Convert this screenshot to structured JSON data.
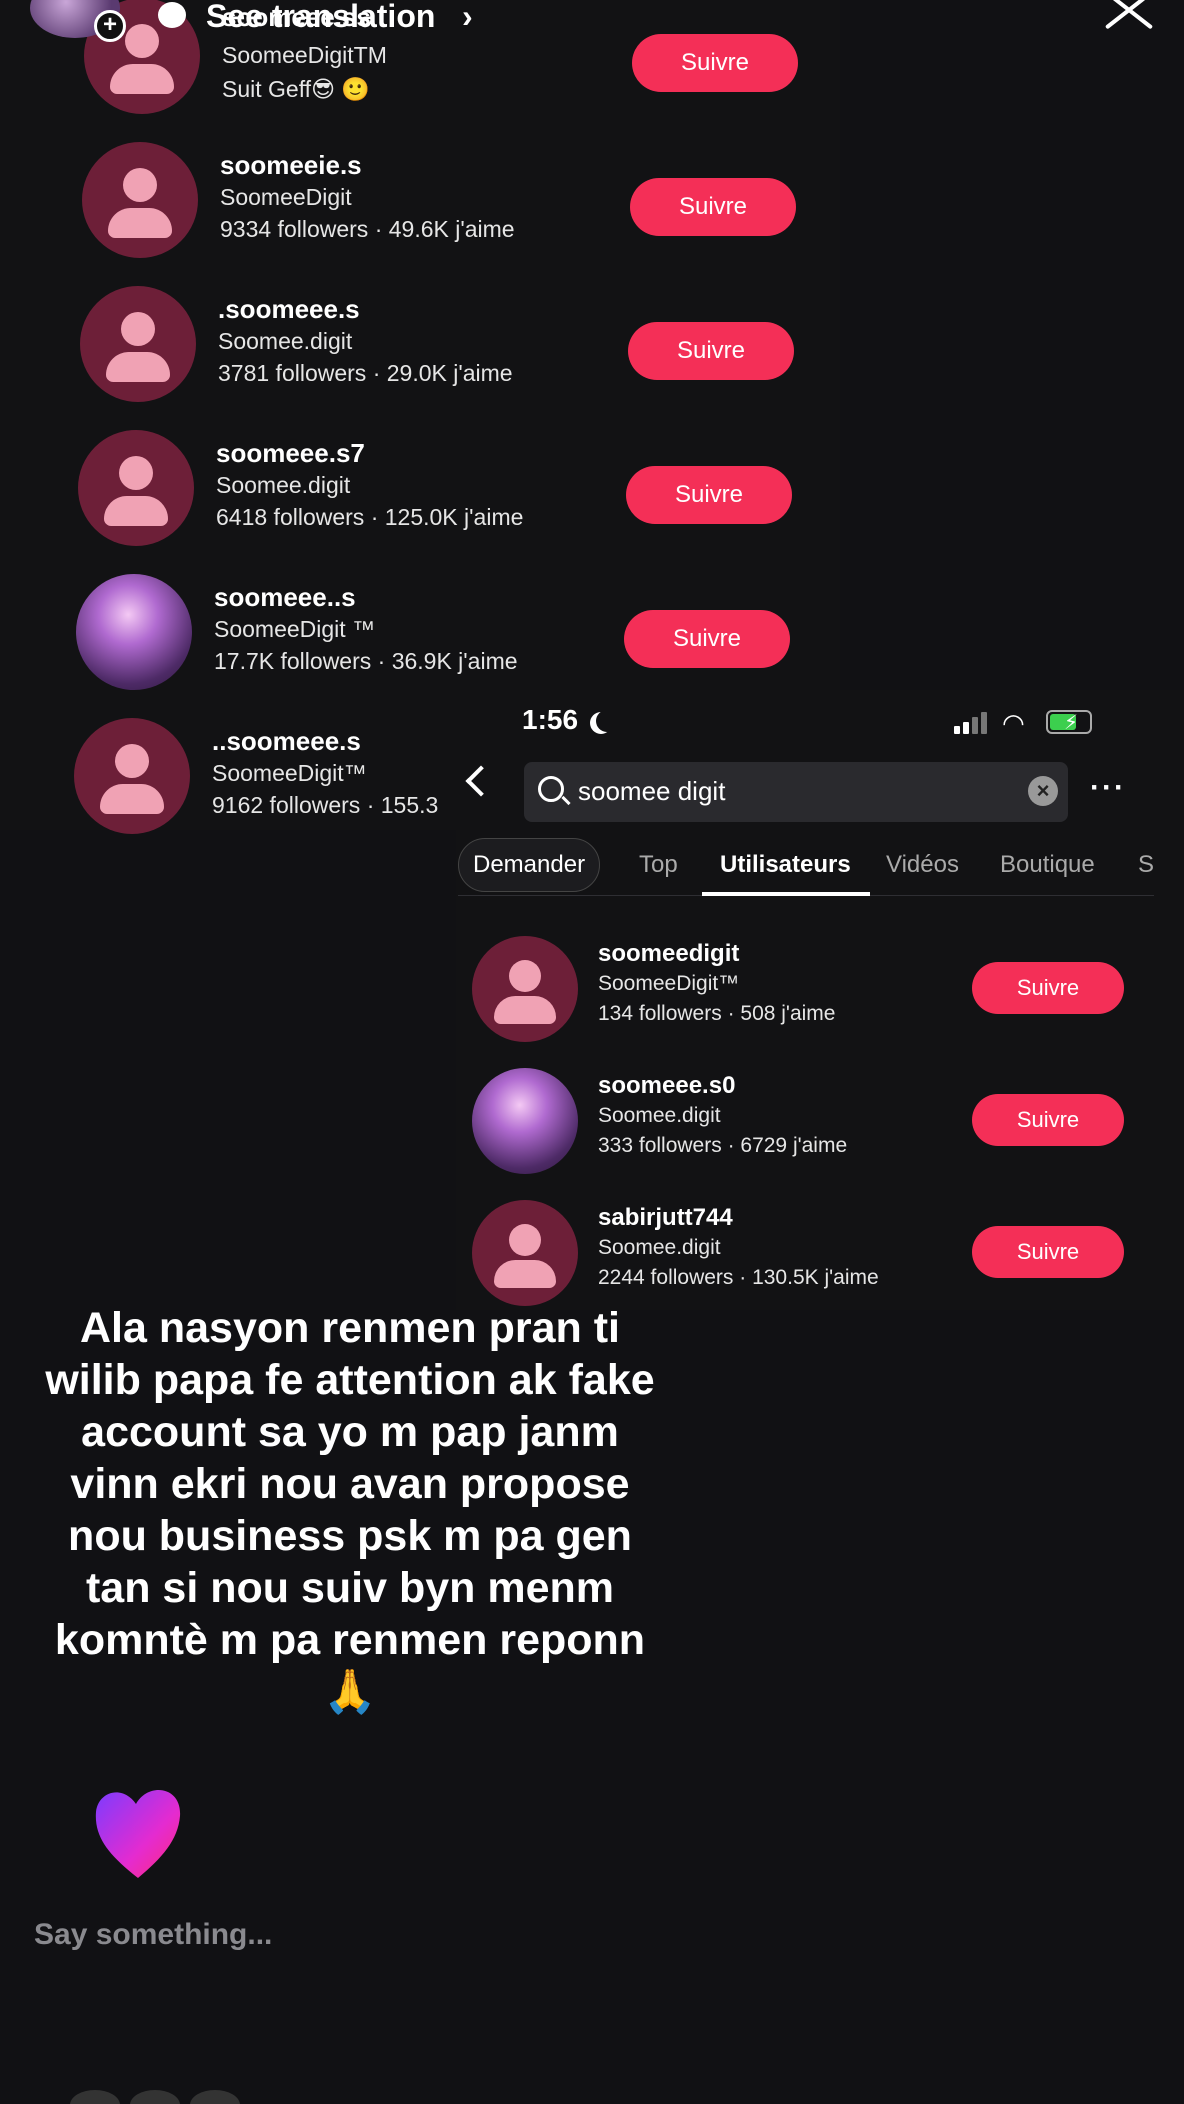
{
  "story_header": {
    "translate_label": "See translation",
    "chevron": "›",
    "plus_icon": "plus-icon",
    "close_icon": "close-icon"
  },
  "list_top": {
    "items": [
      {
        "username": "soomeee.ss",
        "display": "SoomeeDigitTM",
        "stats": "Suit Geff😎 🙂",
        "button": "Suivre"
      },
      {
        "username": "soomeeie.s",
        "display": "SoomeeDigit",
        "stats": "9334 followers · 49.6K j'aime",
        "button": "Suivre"
      },
      {
        "username": ".soomeee.s",
        "display": "Soomee.digit",
        "stats": "3781 followers · 29.0K j'aime",
        "button": "Suivre"
      },
      {
        "username": "soomeee.s7",
        "display": "Soomee.digit",
        "stats": "6418 followers · 125.0K j'aime",
        "button": "Suivre"
      },
      {
        "username": "soomeee..s",
        "display": "SoomeeDigit ™",
        "stats": "17.7K followers · 36.9K j'aime",
        "button": "Suivre"
      },
      {
        "username": "..soomeee.s",
        "display": "SoomeeDigit™",
        "stats": "9162 followers · 155.3",
        "button": ""
      }
    ]
  },
  "status_bar": {
    "time": "1:56"
  },
  "search": {
    "value": "soomee digit"
  },
  "tabs": [
    "Demander",
    "Top",
    "Utilisateurs",
    "Vidéos",
    "Boutique",
    "S"
  ],
  "list_bottom": {
    "items": [
      {
        "username": "soomeedigit",
        "display": "SoomeeDigit™",
        "stats": "134 followers · 508 j'aime",
        "button": "Suivre"
      },
      {
        "username": "soomeee.s0",
        "display": "Soomee.digit",
        "stats": "333 followers · 6729 j'aime",
        "button": "Suivre"
      },
      {
        "username": "sabirjutt744",
        "display": "Soomee.digit",
        "stats": "2244 followers · 130.5K j'aime",
        "button": "Suivre"
      }
    ]
  },
  "story_text": "Ala nasyon renmen pran ti wilib papa fe attention ak fake account sa yo m pap janm vinn ekri nou avan propose nou business psk m pa gen tan si nou suiv byn menm komntè m pa renmen reponn 🙏",
  "comment_input": {
    "placeholder": "Say something..."
  },
  "colors": {
    "follow_button": "#f42f57",
    "avatar_bg": "#6d1f38",
    "avatar_fg": "#f0a2b4",
    "background": "#111114"
  }
}
